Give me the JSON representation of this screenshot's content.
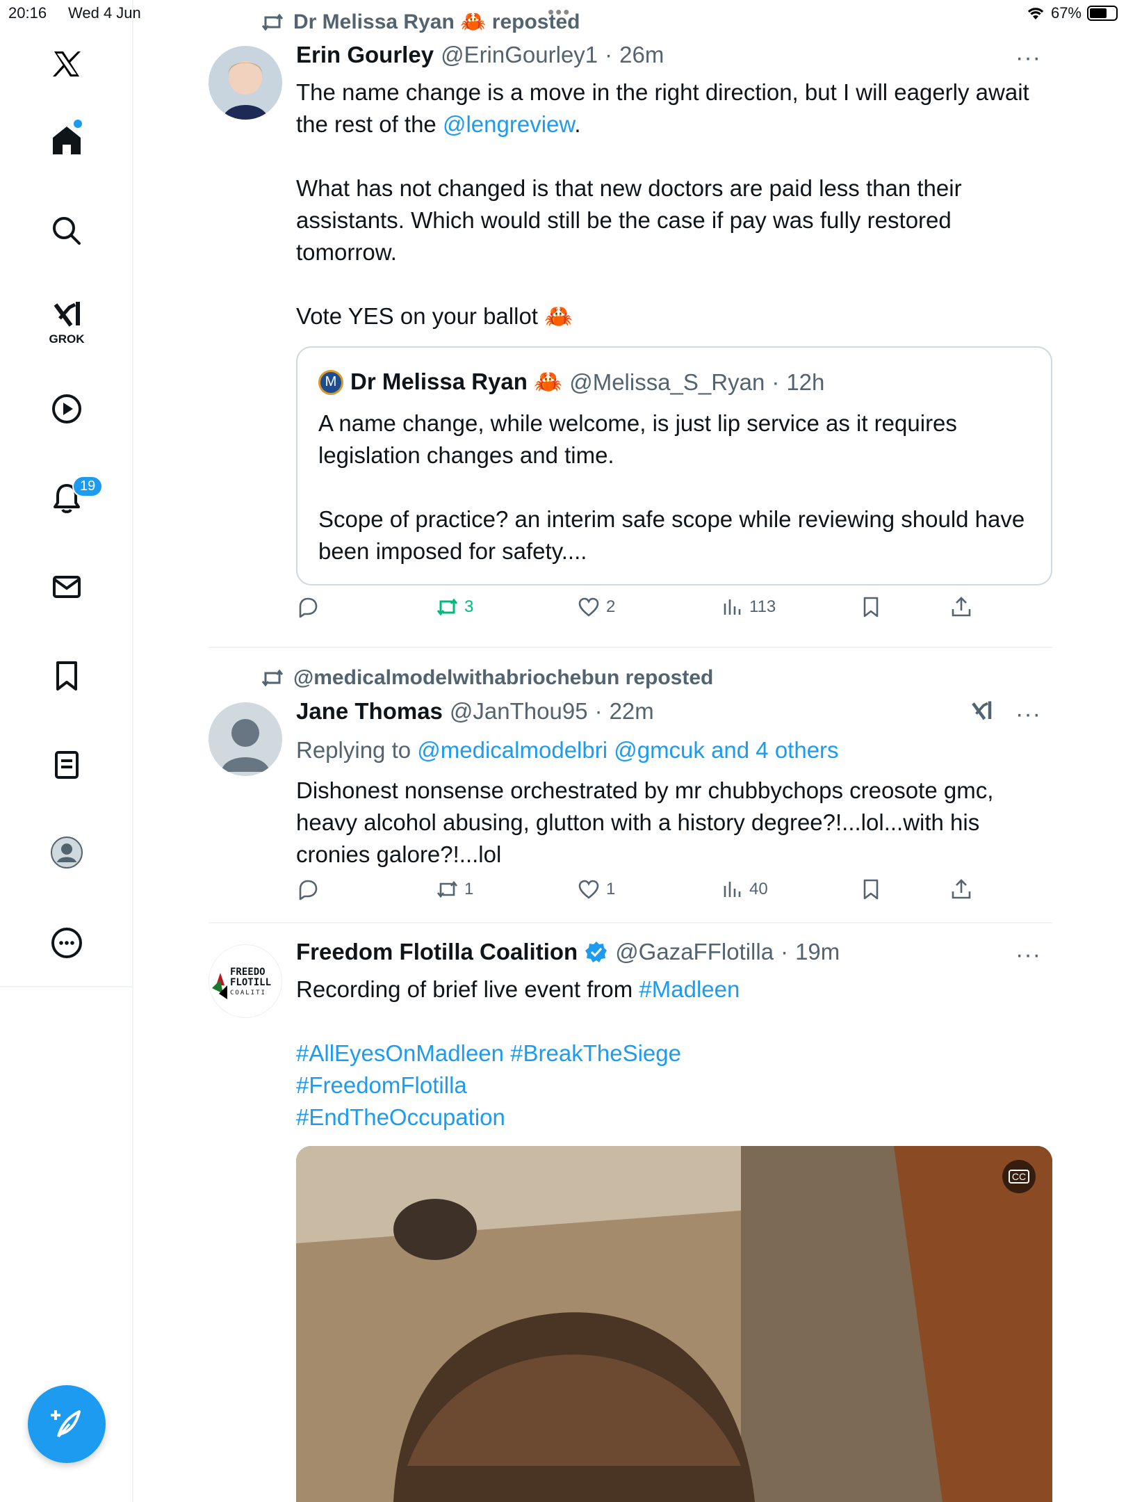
{
  "status_bar": {
    "time": "20:16",
    "date": "Wed 4 Jun",
    "battery": "67%",
    "battery_level": 0.67
  },
  "sidebar": {
    "items": [
      {
        "name": "home",
        "icon": "home-icon"
      },
      {
        "name": "explore",
        "icon": "search-icon"
      },
      {
        "name": "grok",
        "icon": "grok-icon",
        "label": "GROK"
      },
      {
        "name": "video",
        "icon": "play-icon"
      },
      {
        "name": "notifications",
        "icon": "bell-icon",
        "badge": "19"
      },
      {
        "name": "messages",
        "icon": "mail-icon"
      },
      {
        "name": "bookmarks",
        "icon": "bookmark-icon"
      },
      {
        "name": "articles",
        "icon": "article-icon"
      },
      {
        "name": "profile",
        "icon": "profile-icon"
      },
      {
        "name": "more",
        "icon": "more-circle-icon"
      }
    ],
    "compose_icon": "compose-icon"
  },
  "tweets": [
    {
      "repost_by": "Dr Melissa Ryan 🦀 reposted",
      "name": "Erin Gourley",
      "handle": "@ErinGourley1",
      "time": "26m",
      "text_line1_pre": "The name change is a move in the right direction, but I will eagerly await the rest of the ",
      "text_line1_link": "@lengreview",
      "text_line1_post": ".",
      "text_para2": "What has not changed is that new doctors are paid less than their assistants. Which would still be the case if pay was fully restored tomorrow.",
      "text_para3": "Vote YES on your ballot 🦀",
      "quote": {
        "avatar_letter": "M",
        "name": "Dr Melissa Ryan 🦀",
        "handle": "@Melissa_S_Ryan",
        "time": "12h",
        "para1": "A name change, while welcome, is just lip service as it requires legislation changes and time.",
        "para2": "Scope of practice? an interim safe scope while reviewing should have been imposed for safety...."
      },
      "stats": {
        "replies": "",
        "reposts": "3",
        "likes": "2",
        "views": "113"
      }
    },
    {
      "repost_by": "@medicalmodelwithabriochebun reposted",
      "name": "Jane Thomas",
      "handle": "@JanThou95",
      "time": "22m",
      "replying_label": "Replying to",
      "replying_to": "@medicalmodelbri @gmcuk and 4 others",
      "text": "Dishonest nonsense orchestrated by mr chubbychops creosote gmc, heavy alcohol abusing, glutton with a history degree?!...lol...with his cronies galore?!...lol",
      "stats": {
        "replies": "",
        "reposts": "1",
        "likes": "1",
        "views": "40"
      }
    },
    {
      "name": "Freedom Flotilla Coalition",
      "handle": "@GazaFFlotilla",
      "time": "19m",
      "text_pre": "Recording of brief live event from ",
      "text_link": "#Madleen",
      "hashtags_line1": "#AllEyesOnMadleen #BreakTheSiege",
      "hashtags_line2": "#FreedomFlotilla",
      "hashtags_line3": "#EndTheOccupation",
      "avatar_text1": "FREEDO",
      "avatar_text2": "FLOTILL",
      "avatar_text3": "COALITI",
      "cc_label": "CC"
    }
  ],
  "colors": {
    "accent": "#1d9bf0",
    "repost_green": "#00ba7c",
    "muted": "#536471"
  }
}
